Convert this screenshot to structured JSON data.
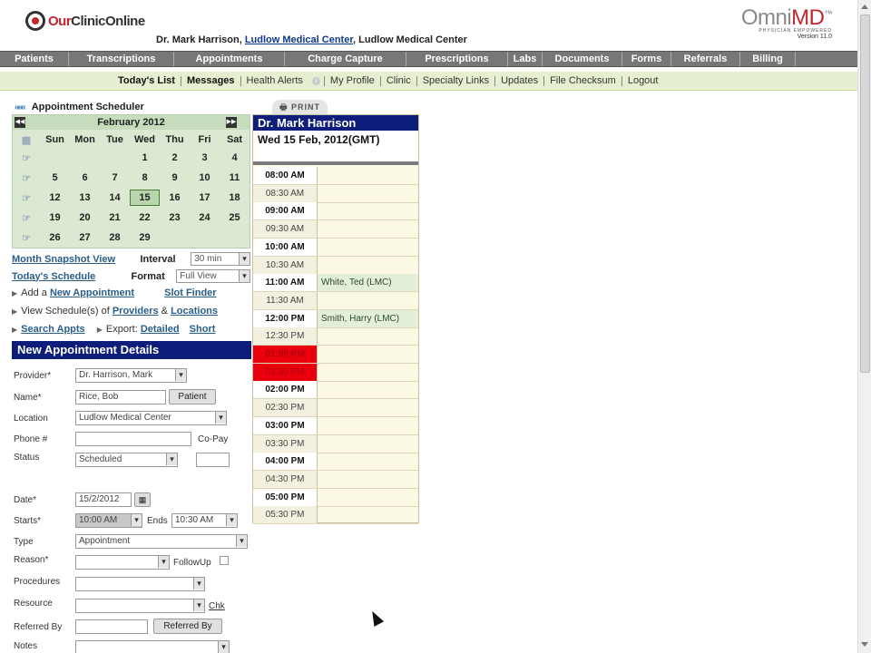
{
  "header": {
    "logo_part1": "Our",
    "logo_part2": "ClinicOnline",
    "doctor": "Dr. Mark Harrison,",
    "center_link": "Ludlow Medical Center",
    "center_plain": ", Ludlow Medical Center",
    "brand_omni": "Omni",
    "brand_md": "MD",
    "brand_tm": "™",
    "brand_tagline": "PHYSICIAN EMPOWERED",
    "brand_version": "Version 11.0"
  },
  "topnav": [
    {
      "label": "Patients",
      "w": 76
    },
    {
      "label": "Transcriptions",
      "w": 116
    },
    {
      "label": "Appointments",
      "w": 122
    },
    {
      "label": "Charge Capture",
      "w": 134
    },
    {
      "label": "Prescriptions",
      "w": 112
    },
    {
      "label": "Labs",
      "w": 38
    },
    {
      "label": "Documents",
      "w": 88
    },
    {
      "label": "Forms",
      "w": 54
    },
    {
      "label": "Referrals",
      "w": 76
    },
    {
      "label": "Billing",
      "w": 61
    }
  ],
  "subnav": {
    "items": [
      "Today's List",
      "Messages",
      "Health Alerts",
      "My Profile",
      "Clinic",
      "Specialty Links",
      "Updates",
      "File Checksum",
      "Logout"
    ],
    "info_icon": "i"
  },
  "scheduler": {
    "title": "Appointment Scheduler",
    "back_icon": "«««",
    "print_label": "PRINT"
  },
  "calendar": {
    "month": "February 2012",
    "prev_icon": "◀◀",
    "next_icon": "▶▶",
    "dow": [
      "Sun",
      "Mon",
      "Tue",
      "Wed",
      "Thu",
      "Fri",
      "Sat"
    ],
    "weeks": [
      [
        "",
        "",
        "",
        "1",
        "2",
        "3",
        "4"
      ],
      [
        "5",
        "6",
        "7",
        "8",
        "9",
        "10",
        "11"
      ],
      [
        "12",
        "13",
        "14",
        "15",
        "16",
        "17",
        "18"
      ],
      [
        "19",
        "20",
        "21",
        "22",
        "23",
        "24",
        "25"
      ],
      [
        "26",
        "27",
        "28",
        "29",
        "",
        "",
        ""
      ]
    ],
    "selected_day": "15",
    "week_icon": "☞",
    "cal_icon": "▦"
  },
  "controls": {
    "month_snapshot": "Month Snapshot View",
    "interval_label": "Interval",
    "interval_value": "30 min",
    "todays_schedule": "Today's Schedule",
    "format_label": "Format",
    "format_value": "Full View",
    "add_a": "Add a",
    "new_appointment": "New Appointment",
    "slot_finder": "Slot Finder",
    "view_schedule": "View Schedule(s) of",
    "providers": "Providers",
    "amp": "&",
    "locations": "Locations",
    "search_appts": "Search Appts",
    "export": "Export:",
    "detailed": "Detailed",
    "short": "Short"
  },
  "form": {
    "title": "New Appointment Details",
    "provider_label": "Provider*",
    "provider_value": "Dr. Harrison, Mark",
    "name_label": "Name*",
    "name_value": "Rice, Bob",
    "patient_btn": "Patient",
    "location_label": "Location",
    "location_value": "Ludlow Medical Center",
    "phone_label": "Phone #",
    "copay_label": "Co-Pay",
    "status_label": "Status",
    "status_value": "Scheduled",
    "date_label": "Date*",
    "date_value": "15/2/2012",
    "starts_label": "Starts*",
    "starts_value": "10:00 AM",
    "ends_label": "Ends",
    "ends_value": "10:30 AM",
    "type_label": "Type",
    "type_value": "Appointment",
    "reason_label": "Reason*",
    "followup_label": "FollowUp",
    "procedures_label": "Procedures",
    "resource_label": "Resource",
    "chk_link": "Chk",
    "referred_label": "Referred By",
    "referred_btn": "Referred By",
    "notes_label": "Notes"
  },
  "schedule": {
    "doctor": "Dr. Mark Harrison",
    "date": "Wed 15 Feb, 2012(GMT)",
    "slots": [
      {
        "time": "08:00 AM",
        "hour": true,
        "appt": ""
      },
      {
        "time": "08:30 AM",
        "hour": false,
        "appt": ""
      },
      {
        "time": "09:00 AM",
        "hour": true,
        "appt": ""
      },
      {
        "time": "09:30 AM",
        "hour": false,
        "appt": ""
      },
      {
        "time": "10:00 AM",
        "hour": true,
        "appt": ""
      },
      {
        "time": "10:30 AM",
        "hour": false,
        "appt": ""
      },
      {
        "time": "11:00 AM",
        "hour": true,
        "appt": "White, Ted (LMC)"
      },
      {
        "time": "11:30 AM",
        "hour": false,
        "appt": ""
      },
      {
        "time": "12:00 PM",
        "hour": true,
        "appt": "Smith, Harry (LMC)"
      },
      {
        "time": "12:30 PM",
        "hour": false,
        "appt": ""
      },
      {
        "time": "01:00 PM",
        "hour": true,
        "appt": "",
        "blocked": true
      },
      {
        "time": "01:30 PM",
        "hour": false,
        "appt": "",
        "blocked": true
      },
      {
        "time": "02:00 PM",
        "hour": true,
        "appt": ""
      },
      {
        "time": "02:30 PM",
        "hour": false,
        "appt": ""
      },
      {
        "time": "03:00 PM",
        "hour": true,
        "appt": ""
      },
      {
        "time": "03:30 PM",
        "hour": false,
        "appt": ""
      },
      {
        "time": "04:00 PM",
        "hour": true,
        "appt": ""
      },
      {
        "time": "04:30 PM",
        "hour": false,
        "appt": ""
      },
      {
        "time": "05:00 PM",
        "hour": true,
        "appt": ""
      },
      {
        "time": "05:30 PM",
        "hour": false,
        "appt": ""
      }
    ]
  }
}
